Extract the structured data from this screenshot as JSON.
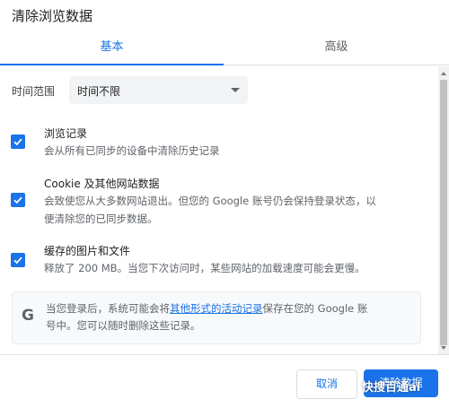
{
  "dialog": {
    "title": "清除浏览数据"
  },
  "tabs": [
    {
      "label": "基本"
    },
    {
      "label": "高级"
    }
  ],
  "time_range": {
    "label": "时间范围",
    "value": "时间不限"
  },
  "options": [
    {
      "title": "浏览记录",
      "desc": "会从所有已同步的设备中清除历史记录",
      "checked": true
    },
    {
      "title": "Cookie 及其他网站数据",
      "desc_line1": "会致使您从大多数网站退出。但您的 Google 账号仍会保持登录状态，以",
      "desc_line2": "便清除您的已同步数据。",
      "checked": true
    },
    {
      "title": "缓存的图片和文件",
      "desc": "释放了 200 MB。当您下次访问时，某些网站的加载速度可能会更慢。",
      "checked": true
    }
  ],
  "info": {
    "icon": "google-g-icon",
    "text_before": "当您登录后，系统可能会将",
    "link": "其他形式的活动记录",
    "text_after": "保存在您的 Google 账",
    "line2": "号中。您可以随时删除这些记录。"
  },
  "buttons": {
    "cancel": "取消",
    "clear": "清除数据"
  },
  "watermark": "快搜百通ai",
  "colors": {
    "accent": "#1a73e8",
    "text": "#202124",
    "secondary": "#5f6368"
  }
}
